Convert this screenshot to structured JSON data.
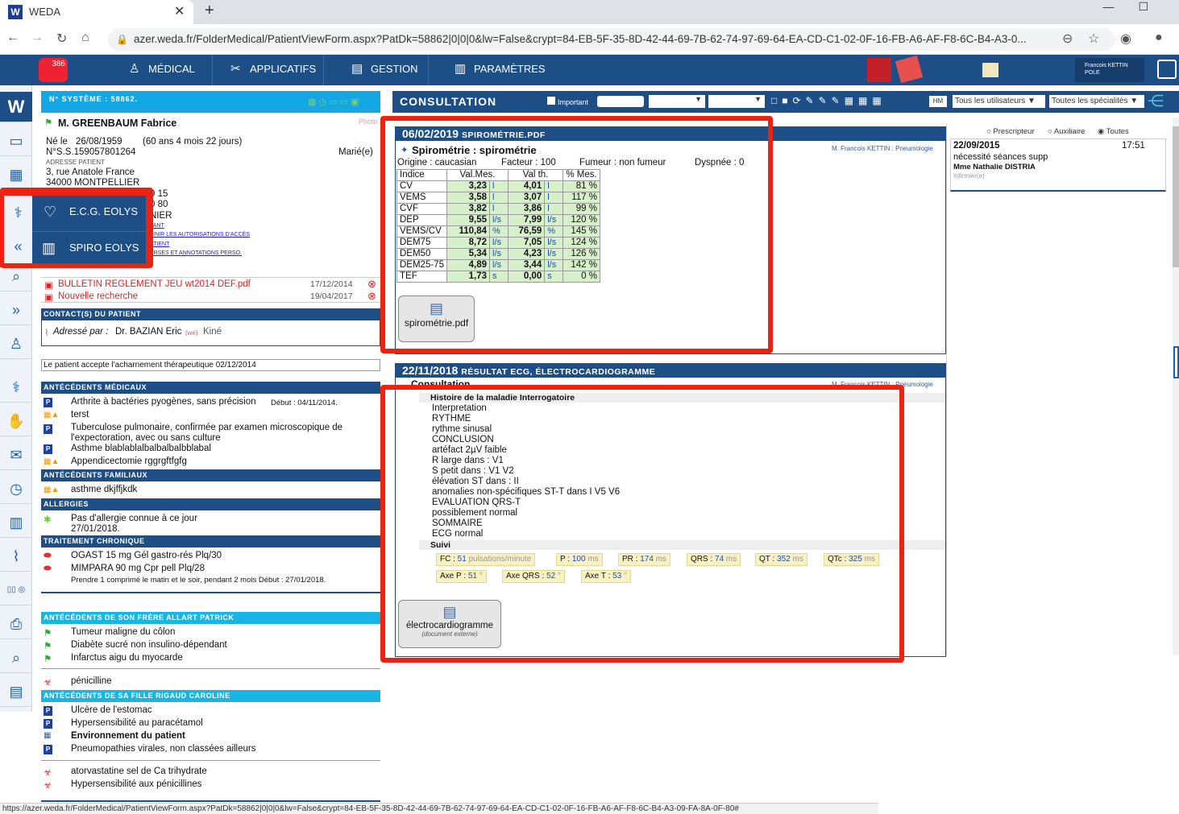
{
  "browser": {
    "tab_title": "WEDA",
    "url": "azer.weda.fr/FolderMedical/PatientViewForm.aspx?PatDk=58862|0|0|0&lw=False&crypt=84-EB-5F-35-8D-42-44-69-7B-62-74-97-69-64-EA-CD-C1-02-0F-16-FB-A6-AF-F8-6C-B4-A3-0...",
    "status_url": "https://azer.weda.fr/FolderMedical/PatientViewForm.aspx?PatDk=58862|0|0|0&lw=False&crypt=84-EB-5F-35-8D-42-44-69-7B-62-74-97-69-64-EA-CD-C1-02-0F-16-FB-A6-AF-F8-6C-B4-A3-09-FA-8A-0F-80#"
  },
  "topnav": {
    "badge": "386",
    "medical": "MÉDICAL",
    "applicatifs": "APPLICATIFS",
    "gestion": "GESTION",
    "parametres": "PARAMÈTRES",
    "user_line1": "Francois KETTIN",
    "user_line2": "POLE"
  },
  "patient": {
    "system_no": "N° SYSTÈME : 58862.",
    "photo": "Photo",
    "name": "M. GREENBAUM Fabrice",
    "born_label": "Né le",
    "born": "26/08/1959",
    "age": "(60 ans 4 mois 22 jours)",
    "ss": "N°S.S.159057801264",
    "marital": "Marié(e)",
    "address_label": "Adresse patient",
    "address1": "3, rue Anatole France",
    "address2": "34000 MONTPELLIER",
    "partial1": "9 15",
    "partial2": "0 80",
    "partial3": "NIER",
    "link1": "TANT",
    "link2": "FINIR LES AUTORISATIONS D'ACCÈS",
    "link3": "ATIENT",
    "link4": "ERSES ET ANNOTATIONS PERSO."
  },
  "popup": {
    "ecg": "E.C.G. EOLYS",
    "spiro": "SPIRO EOLYS"
  },
  "docs": [
    {
      "name": "BULLETIN REGLEMENT JEU wt2014 DEF.pdf",
      "date": "17/12/2014"
    },
    {
      "name": "Nouvelle recherche",
      "date": "19/04/2017"
    }
  ],
  "contacts": {
    "title": "Contact(s) du patient",
    "addressed_by": "Adressé par :",
    "doctor": "Dr. BAZIAN Eric",
    "we": "(we)",
    "role": "Kiné"
  },
  "note": "Le patient accepte l'acharnement thérapeutique 02/12/2014",
  "atcd_med": {
    "title": "Antécédents médicaux",
    "items": [
      "Arthrite à bactéries pyogènes, sans précision",
      "terst",
      "Tuberculose pulmonaire, confirmée par examen microscopique de",
      "l'expectoration, avec ou sans culture",
      "Asthme blablablalbalbalbalbblabal",
      "Appendicectomie rggrgftfgfg"
    ],
    "debut": "Début : 04/11/2014."
  },
  "atcd_fam": {
    "title": "Antécédents Familiaux",
    "item": "asthme dkjffjkdk"
  },
  "allergies": {
    "title": "ALLERGIES",
    "item": "Pas d'allergie connue à ce jour",
    "date": "27/01/2018."
  },
  "traitement": {
    "title": "Traitement chronique",
    "item1": "OGAST 15 mg Gél gastro-rés Plq/30",
    "item2": "MIMPARA 90 mg Cpr pell Plq/28",
    "posology": "Prendre 1 comprimé le matin et le soir, pendant 2 mois Début : 27/01/2018."
  },
  "frere": {
    "title": "Antécédents de son Frère ALLART Patrick",
    "items": [
      "Tumeur maligne du côlon",
      "Diabète sucré non insulino-dépendant",
      "Infarctus aigu du myocarde",
      "pénicilline"
    ]
  },
  "fille": {
    "title": "Antécédents de sa Fille RIGAUD Caroline",
    "items": [
      "Ulcère de l'estomac",
      "Hypersensibilité au paracétamol",
      "Environnement du patient",
      "Pneumopathies virales, non classées ailleurs",
      "atorvastatine sel de Ca trihydrate",
      "Hypersensibilité aux pénicillines"
    ]
  },
  "consultation": {
    "title": "CONSULTATION",
    "important": "Important",
    "hm": "HM",
    "users_select": "Tous les utilisateurs",
    "spec_select": "Toutes les spécialités"
  },
  "spiro_card": {
    "date": "06/02/2019",
    "type": "SPIROMÉTRIE.PDF",
    "author": "M. Francois KETTIN : Pneumologie",
    "title": "Spirométrie : spirométrie",
    "origine": "Origine : caucasian",
    "facteur": "Facteur : 100",
    "fumeur": "Fumeur : non fumeur",
    "dyspnee": "Dyspnée : 0",
    "headers": [
      "Indice",
      "Val.Mes.",
      "Val th.",
      "% Mes."
    ],
    "rows": [
      [
        "CV",
        "3,23",
        "l",
        "4,01",
        "l",
        "81 %"
      ],
      [
        "VEMS",
        "3,58",
        "l",
        "3,07",
        "l",
        "117 %"
      ],
      [
        "CVF",
        "3,82",
        "l",
        "3,86",
        "l",
        "99 %"
      ],
      [
        "DEP",
        "9,55",
        "l/s",
        "7,99",
        "l/s",
        "120 %"
      ],
      [
        "VEMS/CV",
        "110,84",
        "%",
        "76,59",
        "%",
        "145 %"
      ],
      [
        "DEM75",
        "8,72",
        "l/s",
        "7,05",
        "l/s",
        "124 %"
      ],
      [
        "DEM50",
        "5,34",
        "l/s",
        "4,23",
        "l/s",
        "126 %"
      ],
      [
        "DEM25-75",
        "4,89",
        "l/s",
        "3,44",
        "l/s",
        "142 %"
      ],
      [
        "TEF",
        "1,73",
        "s",
        "0,00",
        "s",
        "0 %"
      ]
    ],
    "doc_btn": "spirométrie.pdf"
  },
  "ecg_card": {
    "date": "22/11/2018",
    "type": "RÉSULTAT ECG, ÉLECTROCARDIOGRAMME",
    "author": "M. Francois KETTIN : Pneumologie",
    "consultation": "Consultation",
    "history": "Histoire de la maladie Interrogatoire",
    "lines": [
      "Interpretation",
      "RYTHME",
      "rythme sinusal",
      "CONCLUSION",
      "artéfact 2µV faible",
      "R large dans : V1",
      "S petit dans : V1 V2",
      "élévation ST dans : II",
      "anomalies non-spécifiques ST-T dans I V5 V6",
      "EVALUATION QRS-T",
      "possiblement normal",
      "SOMMAIRE",
      "ECG normal"
    ],
    "suivi": "Suivi",
    "tags": [
      {
        "k": "FC : ",
        "v": "51",
        "u": " pulsations/minute"
      },
      {
        "k": "P : ",
        "v": "100",
        "u": " ms"
      },
      {
        "k": "PR : ",
        "v": "174",
        "u": " ms"
      },
      {
        "k": "QRS : ",
        "v": "74",
        "u": " ms"
      },
      {
        "k": "QT : ",
        "v": "352",
        "u": " ms"
      },
      {
        "k": "QTc : ",
        "v": "325",
        "u": " ms"
      },
      {
        "k": "Axe P : ",
        "v": "51",
        "u": " °"
      },
      {
        "k": "Axe QRS : ",
        "v": "52",
        "u": " °"
      },
      {
        "k": "Axe T : ",
        "v": "53",
        "u": " °"
      }
    ],
    "doc_btn": "électrocardiogramme",
    "doc_sub": "(document externe)"
  },
  "right_panel": {
    "radio1": "Prescripteur",
    "radio2": "Auxiliaire",
    "radio3": "Toutes",
    "date": "22/09/2015",
    "time": "17:51",
    "text": "nécessité séances supp",
    "author": "Mme Nathalie DISTRIA",
    "role": "Infirmier(e)"
  },
  "colors": {
    "navy": "#1e4e86",
    "cyan": "#13a7e4",
    "highlight_red": "#e21"
  }
}
